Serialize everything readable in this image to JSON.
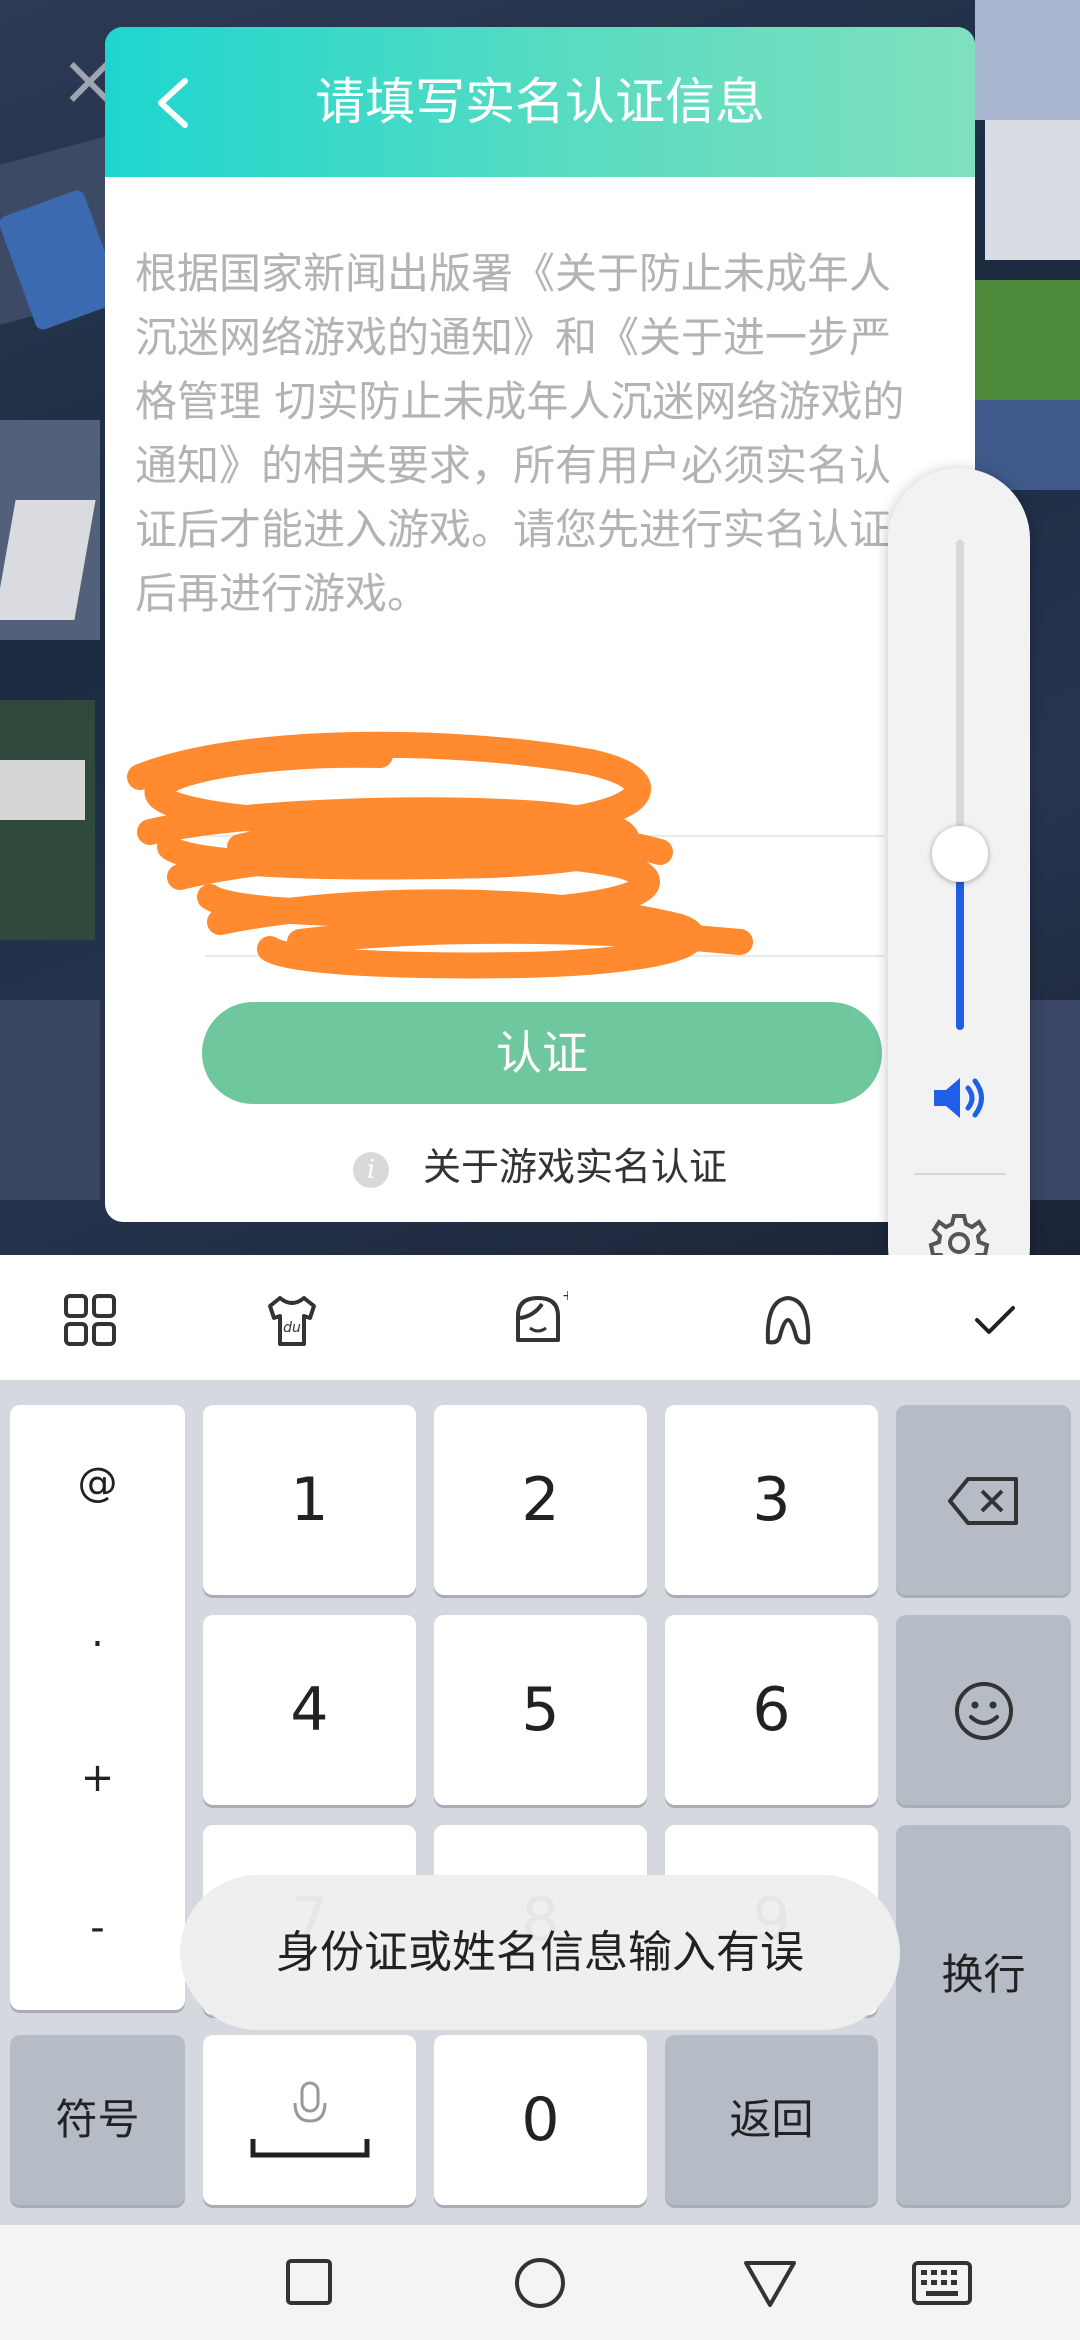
{
  "dialog": {
    "title": "请填写实名认证信息",
    "body": "根据国家新闻出版署《关于防止未成年人沉迷网络游戏的通知》和《关于进一步严格管理 切实防止未成年人沉迷网络游戏的通知》的相关要求，所有用户必须实名认证后才能进入游戏。请您先进行实名认证后再进行游戏。",
    "submit_label": "认证",
    "about_link": "关于游戏实名认证"
  },
  "volume": {
    "level": 0.36,
    "accent": "#1f5ee6"
  },
  "keyboard": {
    "symbols": [
      "@",
      ".",
      "+",
      "-"
    ],
    "keys": [
      "1",
      "2",
      "3",
      "4",
      "5",
      "6",
      "7",
      "8",
      "9",
      "0"
    ],
    "symbol_key": "符号",
    "back_key": "返回",
    "enter_key": "换行"
  },
  "toast": "身份证或姓名信息输入有误",
  "icons": {
    "toolbar": [
      "grid-icon",
      "skin-tshirt-icon",
      "emoji-face-icon",
      "handwriting-icon",
      "collapse-check-icon"
    ],
    "nav": [
      "recent-apps-icon",
      "home-icon",
      "back-icon",
      "keyboard-icon"
    ]
  },
  "colors": {
    "header_start": "#1ed6cf",
    "header_end": "#7fe0bf",
    "button": "#6fc79e"
  }
}
